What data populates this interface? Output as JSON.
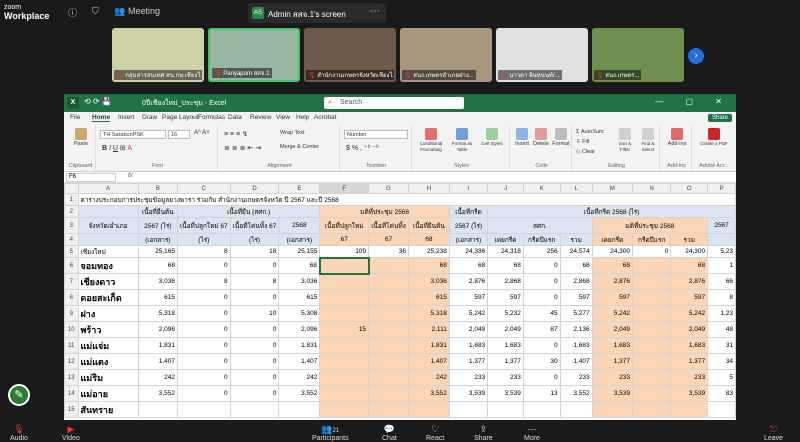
{
  "zoom": {
    "brand_line1": "zoom",
    "brand_line2": "Workplace",
    "meeting_label": "Meeting",
    "share_badge": "AS",
    "share_label": "Admin สสจ.1's screen",
    "thumbs": [
      {
        "caption": "กลุ่มสารสนเทศ สน.กษ.เชียงใ...",
        "color": "#cfcfa8"
      },
      {
        "caption": "Pariyapom สสจ.1",
        "color": "#9bb6a0"
      },
      {
        "caption": "สำนักงานเกษตรจังหวัดเชียงใ...",
        "color": "#6e5a4a"
      },
      {
        "caption": "สนง.เกษตรอำเภอฝาง...",
        "color": "#a7977e"
      },
      {
        "caption": "นาวดา อินทนนท์/...",
        "color": "#e0e0e0"
      },
      {
        "caption": "สนง.เกษตร...",
        "color": "#6f8f4f"
      }
    ],
    "bottom": {
      "audio": "Audio",
      "video": "Video",
      "participants": "Participants",
      "participants_count": "21",
      "chat": "Chat",
      "react": "React",
      "share": "Share",
      "more": "More",
      "leave": "Leave"
    }
  },
  "excel": {
    "filename": "0ปีเชียงใหม่_ประชุม - Excel",
    "search_placeholder": "Search",
    "menu": [
      "File",
      "Home",
      "Insert",
      "Draw",
      "Page Layout",
      "Formulas",
      "Data",
      "Review",
      "View",
      "Help",
      "Acrobat"
    ],
    "share": "Share",
    "ribbon": {
      "font_name": "TH SarabunPSK",
      "font_size": "16",
      "number_format": "Number",
      "wrap_text": "Wrap Text",
      "merge_center": "Merge & Center",
      "autosum": "AutoSum",
      "fill": "Fill",
      "clear": "Clear",
      "groups": {
        "clipboard": "Clipboard",
        "font": "Font",
        "alignment": "Alignment",
        "number": "Number",
        "styles": "Styles",
        "cells": "Cells",
        "editing": "Editing",
        "addins": "Add-ins",
        "adobe": "Adobe Acr..."
      },
      "buttons": {
        "paste": "Paste",
        "cond": "Conditional Formatting",
        "format_table": "Format as Table",
        "cell_styles": "Cell Styles",
        "insert": "Insert",
        "delete": "Delete",
        "format": "Format",
        "sort": "Sort & Filter",
        "find": "Find & Select",
        "addins": "Add-ins",
        "pdf": "Create a PDF"
      }
    },
    "cell_ref": "F6",
    "fx": "fx",
    "columns": [
      "A",
      "B",
      "C",
      "D",
      "E",
      "F",
      "G",
      "H",
      "I",
      "J",
      "K",
      "L",
      "M",
      "N",
      "O",
      "P"
    ],
    "title_row": "ตารางประกอบการประชุมข้อมูลยางพารา ร่วมกับ สำนักงานเกษตรจังหวัด ปี 2567 และปี 2568",
    "header": {
      "b1": "เนื้อที่ยืนต้น",
      "b2": "2567 (ไร่)",
      "b3": "(เอกสาร)",
      "cd1": "เนื้อที่ยืน (สศก.)",
      "c2": "เนื้อที่ปลูกใหม่ 67",
      "c3": "(ไร่)",
      "d2": "เนื้อที่โค่นทิ้ง 67",
      "d3": "(ไร่)",
      "e2": "2568",
      "e3": "(เอกสาร)",
      "fgh1": "มติที่ประชุม 2568",
      "f2": "เนื้อที่ปลูกใหม่",
      "f3": "67",
      "g2": "เนื้อที่โค่นทิ้ง",
      "g3": "67",
      "h2": "เนื้อที่ยืนต้น",
      "h3": "68",
      "i1": "เนื้อที่กรีด",
      "i2": "2567 (ไร่)",
      "i3": "(เอกสาร)",
      "jo1": "เนื้อที่กรีด 2568 (ไร่)",
      "jkl2": "สศก.",
      "mno2": "มติที่ประชุม 2568",
      "j3": "เคยกรีด",
      "k3": "กรีดปีแรก",
      "l3": "รวม",
      "m3": "เคยกรีด",
      "n3": "กรีดปีแรก",
      "o3": "รวม",
      "p2": "2567",
      "a2": "จังหวัด/อำเภอ"
    },
    "rows": [
      {
        "n": "5",
        "a": "เชียงใหม่",
        "b": "25,165",
        "c": "8",
        "d": "18",
        "e": "25,155",
        "f": "109",
        "g": "36",
        "h": "25,238",
        "i": "24,336",
        "j": "24,318",
        "k": "256",
        "l": "24,574",
        "m": "24,300",
        "n2": "0",
        "o": "24,300",
        "p": "5,23"
      },
      {
        "n": "6",
        "a": "จอมทอง",
        "b": "68",
        "c": "0",
        "d": "0",
        "e": "68",
        "f": "",
        "g": "",
        "h": "68",
        "i": "68",
        "j": "68",
        "k": "0",
        "l": "68",
        "m": "68",
        "n2": "",
        "o": "68",
        "p": "1"
      },
      {
        "n": "7",
        "a": "เชียงดาว",
        "b": "3,036",
        "c": "8",
        "d": "8",
        "e": "3,036",
        "f": "",
        "g": "",
        "h": "3,036",
        "i": "2,876",
        "j": "2,868",
        "k": "0",
        "l": "2,868",
        "m": "2,876",
        "n2": "",
        "o": "2,876",
        "p": "66"
      },
      {
        "n": "8",
        "a": "ดอยสะเก็ด",
        "b": "615",
        "c": "0",
        "d": "0",
        "e": "615",
        "f": "",
        "g": "",
        "h": "615",
        "i": "597",
        "j": "597",
        "k": "0",
        "l": "597",
        "m": "597",
        "n2": "",
        "o": "597",
        "p": "8"
      },
      {
        "n": "9",
        "a": "ฝาง",
        "b": "5,318",
        "c": "0",
        "d": "10",
        "e": "5,308",
        "f": "",
        "g": "",
        "h": "5,318",
        "i": "5,242",
        "j": "5,232",
        "k": "45",
        "l": "5,277",
        "m": "5,242",
        "n2": "",
        "o": "5,242",
        "p": "1,23"
      },
      {
        "n": "10",
        "a": "พร้าว",
        "b": "2,096",
        "c": "0",
        "d": "0",
        "e": "2,096",
        "f": "15",
        "g": "",
        "h": "2,111",
        "i": "2,049",
        "j": "2,049",
        "k": "87",
        "l": "2,136",
        "m": "2,049",
        "n2": "",
        "o": "2,049",
        "p": "48"
      },
      {
        "n": "11",
        "a": "แม่แจ่ม",
        "b": "1,831",
        "c": "0",
        "d": "0",
        "e": "1,831",
        "f": "",
        "g": "",
        "h": "1,831",
        "i": "1,683",
        "j": "1,683",
        "k": "0",
        "l": "1,683",
        "m": "1,683",
        "n2": "",
        "o": "1,683",
        "p": "31"
      },
      {
        "n": "12",
        "a": "แม่แตง",
        "b": "1,407",
        "c": "0",
        "d": "0",
        "e": "1,407",
        "f": "",
        "g": "",
        "h": "1,407",
        "i": "1,377",
        "j": "1,377",
        "k": "30",
        "l": "1,407",
        "m": "1,377",
        "n2": "",
        "o": "1,377",
        "p": "34"
      },
      {
        "n": "13",
        "a": "แม่ริม",
        "b": "242",
        "c": "0",
        "d": "0",
        "e": "242",
        "f": "",
        "g": "",
        "h": "242",
        "i": "233",
        "j": "233",
        "k": "0",
        "l": "233",
        "m": "233",
        "n2": "",
        "o": "233",
        "p": "5"
      },
      {
        "n": "14",
        "a": "แม่อาย",
        "b": "3,552",
        "c": "0",
        "d": "0",
        "e": "3,552",
        "f": "",
        "g": "",
        "h": "3,552",
        "i": "3,539",
        "j": "3,539",
        "k": "13",
        "l": "3,552",
        "m": "3,539",
        "n2": "",
        "o": "3,539",
        "p": "83"
      },
      {
        "n": "15",
        "a": "สันทราย",
        "b": "",
        "c": "",
        "d": "",
        "e": "",
        "f": "",
        "g": "",
        "h": "",
        "i": "",
        "j": "",
        "k": "",
        "l": "",
        "m": "",
        "n2": "",
        "o": "",
        "p": ""
      }
    ]
  }
}
